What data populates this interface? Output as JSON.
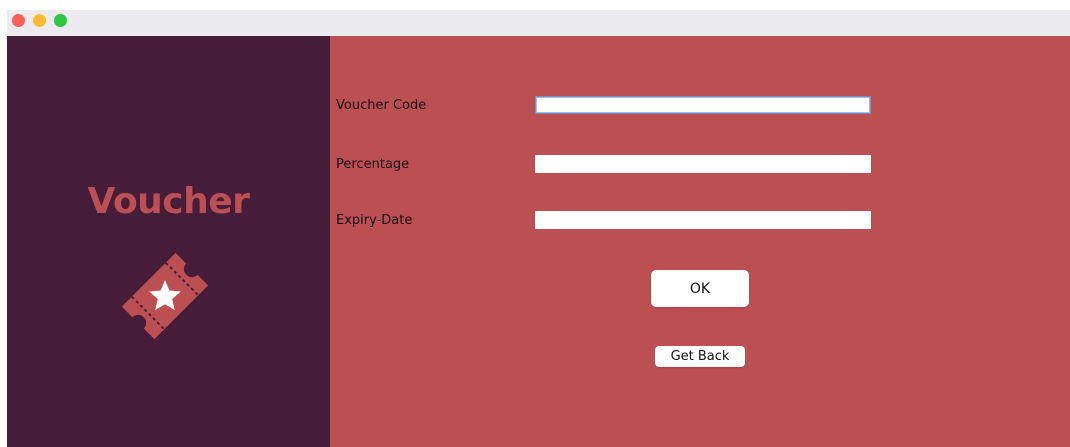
{
  "colors": {
    "sidebar_bg": "#451d3b",
    "main_bg": "#bc4f51",
    "accent": "#bc4f51",
    "traffic_close": "#fe5f57",
    "traffic_minimize": "#febc2e",
    "traffic_maximize": "#28c840"
  },
  "sidebar": {
    "title": "Voucher",
    "icon": "ticket-star-icon"
  },
  "form": {
    "fields": [
      {
        "label": "Voucher Code",
        "value": ""
      },
      {
        "label": "Percentage",
        "value": ""
      },
      {
        "label": "Expiry-Date",
        "value": ""
      }
    ]
  },
  "buttons": {
    "ok_label": "OK",
    "back_label": "Get Back"
  }
}
